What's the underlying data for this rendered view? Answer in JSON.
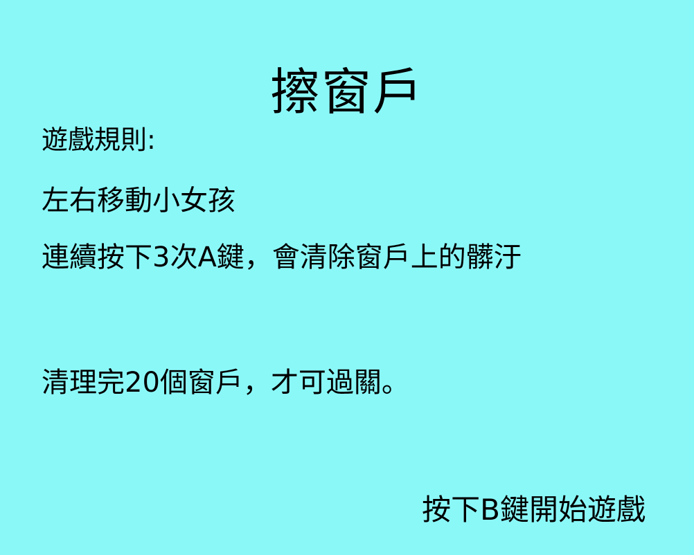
{
  "title": "擦窗戶",
  "rules": {
    "heading": "遊戲規則:",
    "lines": [
      "左右移動小女孩",
      "連續按下3次A鍵，會清除窗戶上的髒汙",
      "清理完20個窗戶，才可過關。"
    ]
  },
  "start_prompt": "按下B鍵開始遊戲",
  "colors": {
    "background": "#8BF8F8",
    "text": "#000000"
  }
}
